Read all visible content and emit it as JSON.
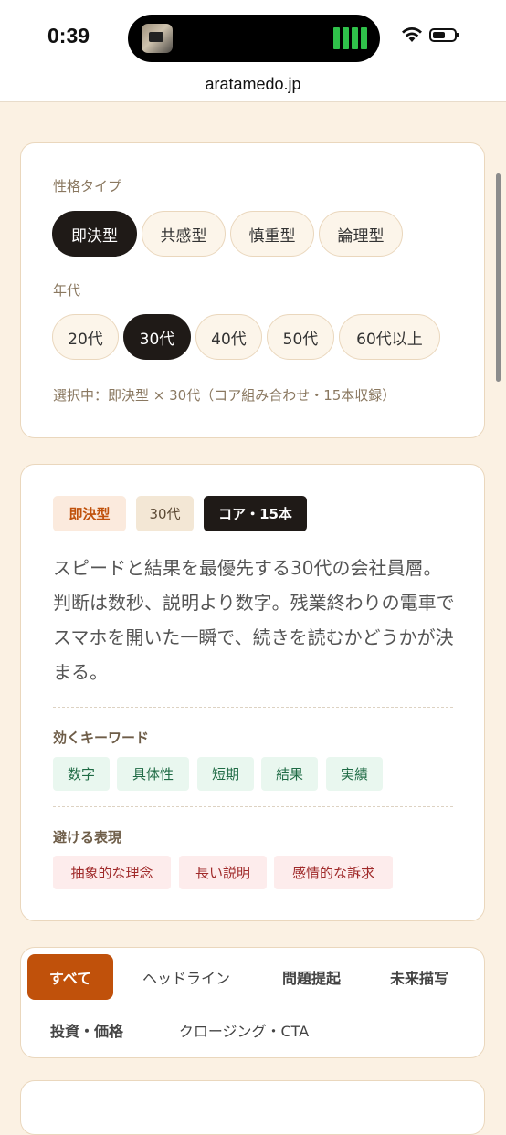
{
  "status_bar": {
    "time": "0:39"
  },
  "browser": {
    "url": "aratamedo.jp"
  },
  "filters": {
    "personality_label": "性格タイプ",
    "personality_options": [
      "即決型",
      "共感型",
      "慎重型",
      "論理型"
    ],
    "personality_selected": "即決型",
    "age_label": "年代",
    "age_options": [
      "20代",
      "30代",
      "40代",
      "50代",
      "60代以上"
    ],
    "age_selected": "30代",
    "selection_summary": "選択中：即決型 × 30代（コア組み合わせ・15本収録）"
  },
  "profile": {
    "tags": [
      "即決型",
      "30代",
      "コア・15本"
    ],
    "description": "スピードと結果を最優先する30代の会社員層。判断は数秒、説明より数字。残業終わりの電車でスマホを開いた一瞬で、続きを読むかどうかが決まる。",
    "keywords_label": "効くキーワード",
    "keywords": [
      "数字",
      "具体性",
      "短期",
      "結果",
      "実績"
    ],
    "avoid_label": "避ける表現",
    "avoid": [
      "抽象的な理念",
      "長い説明",
      "感情的な訴求"
    ]
  },
  "categories": {
    "tabs": [
      "すべて",
      "ヘッドライン",
      "問題提起",
      "未来描写",
      "投資・価格",
      "クロージング・CTA"
    ],
    "selected": "すべて"
  },
  "colors": {
    "background": "#fbf1e3",
    "accent": "#c0510b",
    "dark": "#1f1a17",
    "keyword_bg": "#e9f7ef",
    "avoid_bg": "#fdecec"
  }
}
